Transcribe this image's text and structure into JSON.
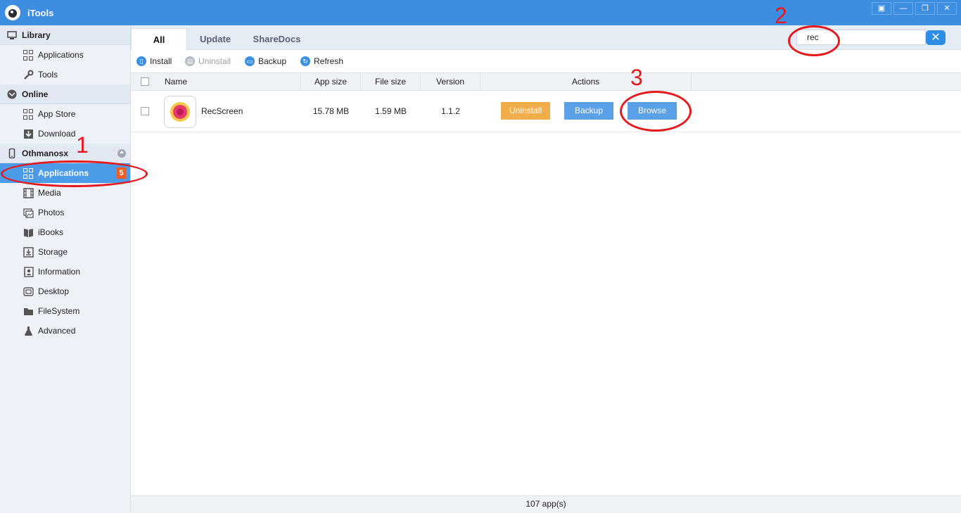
{
  "window": {
    "title": "iTools",
    "controls": [
      "▣",
      "—",
      "❐",
      "✕"
    ]
  },
  "sidebar": {
    "library": {
      "label": "Library",
      "items": [
        {
          "label": "Applications",
          "icon": "grid-icon"
        },
        {
          "label": "Tools",
          "icon": "wrench-icon"
        }
      ]
    },
    "online": {
      "label": "Online",
      "items": [
        {
          "label": "App Store",
          "icon": "grid-icon"
        },
        {
          "label": "Download",
          "icon": "download-icon"
        }
      ]
    },
    "device": {
      "label": "Othmanosx",
      "items": [
        {
          "label": "Applications",
          "icon": "grid-icon",
          "badge": "5",
          "active": true
        },
        {
          "label": "Media",
          "icon": "film-icon"
        },
        {
          "label": "Photos",
          "icon": "photo-icon"
        },
        {
          "label": "iBooks",
          "icon": "book-icon"
        },
        {
          "label": "Storage",
          "icon": "storage-icon"
        },
        {
          "label": "Information",
          "icon": "contact-icon"
        },
        {
          "label": "Desktop",
          "icon": "desktop-icon"
        },
        {
          "label": "FileSystem",
          "icon": "folder-icon"
        },
        {
          "label": "Advanced",
          "icon": "flask-icon"
        }
      ]
    }
  },
  "tabs": [
    {
      "label": "All",
      "active": true
    },
    {
      "label": "Update"
    },
    {
      "label": "ShareDocs"
    }
  ],
  "search": {
    "value": "rec",
    "clear": "✕"
  },
  "toolbar": {
    "install": "Install",
    "uninstall": "Uninstall",
    "backup": "Backup",
    "refresh": "Refresh"
  },
  "table": {
    "columns": {
      "name": "Name",
      "app_size": "App size",
      "file_size": "File size",
      "version": "Version",
      "actions": "Actions"
    },
    "rows": [
      {
        "name": "RecScreen",
        "app_size": "15.78 MB",
        "file_size": "1.59 MB",
        "version": "1.1.2",
        "actions": {
          "uninstall": "Uninstall",
          "backup": "Backup",
          "browse": "Browse"
        }
      }
    ]
  },
  "status": {
    "count": "107 app(s)"
  },
  "annotations": {
    "one": "1",
    "two": "2",
    "three": "3"
  },
  "colors": {
    "titlebar": "#3d8ee0",
    "active": "#4b9be8",
    "uninstall_btn": "#f2ad4b",
    "action_btn": "#5aa1e8",
    "annotation": "#e6191c",
    "badge": "#f25d23"
  }
}
